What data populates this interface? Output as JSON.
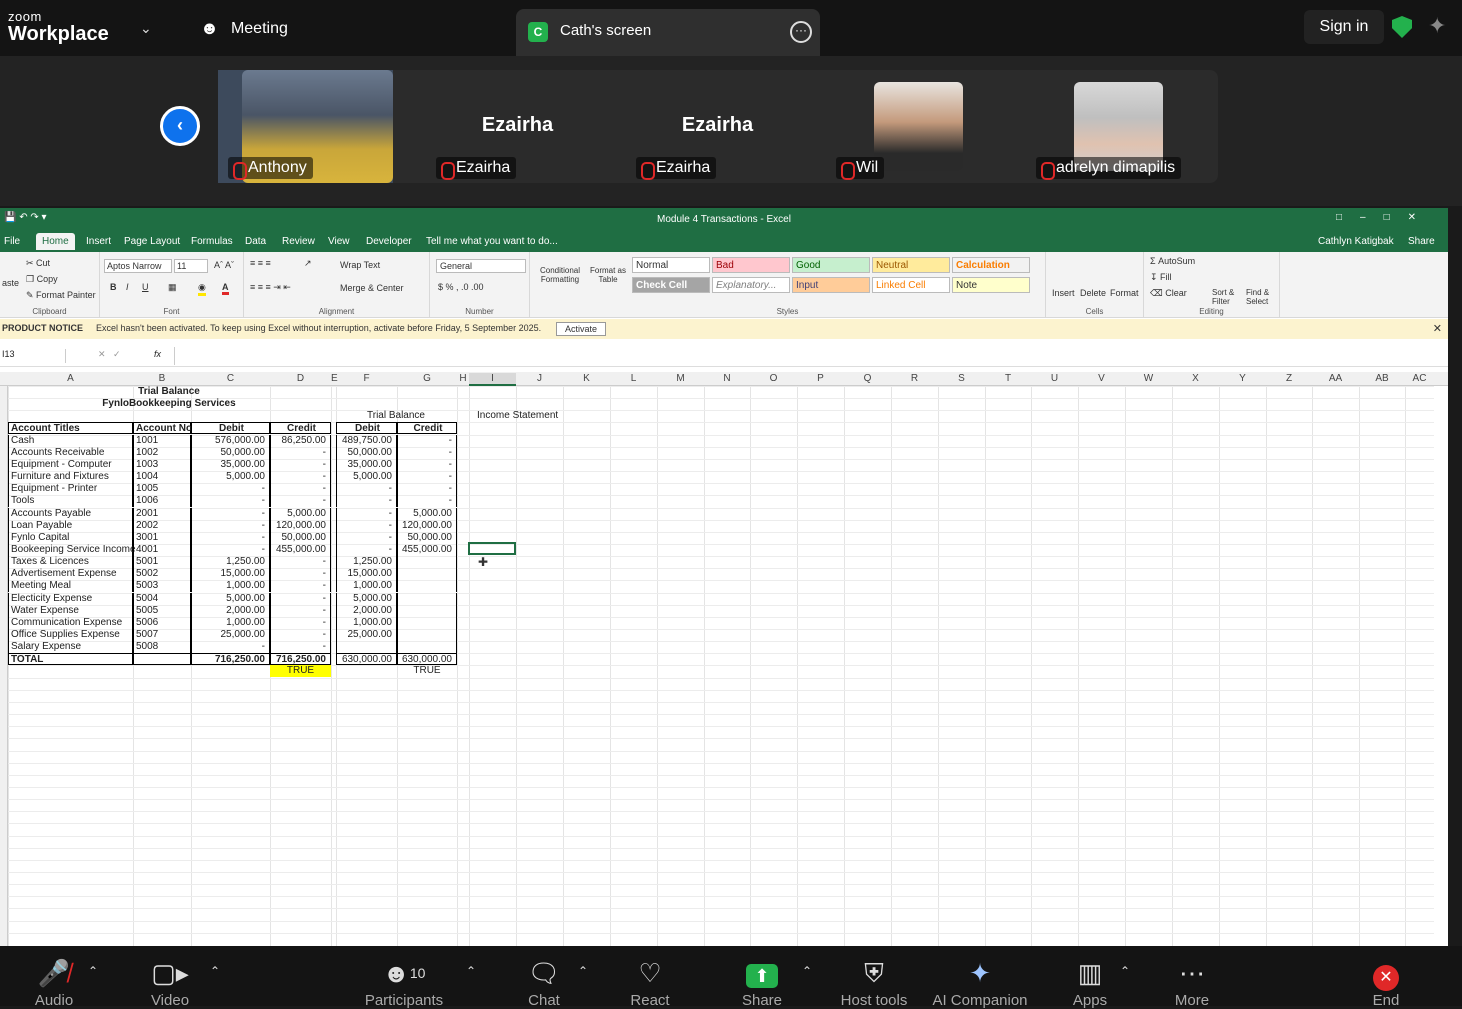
{
  "top": {
    "brand_small": "zoom",
    "brand_big": "Workplace",
    "meeting_label": "Meeting",
    "share_tab_initial": "C",
    "share_tab_title": "Cath's screen",
    "sign_in": "Sign in"
  },
  "participants": [
    {
      "name": "Anthony",
      "video": true
    },
    {
      "name": "Ezairha",
      "video": false,
      "display": "Ezairha"
    },
    {
      "name": "Ezairha",
      "video": false,
      "display": "Ezairha"
    },
    {
      "name": "Wil",
      "video": true
    },
    {
      "name": "adrelyn dimapilis",
      "video": true
    }
  ],
  "excel": {
    "title": "Module 4 Transactions - Excel",
    "menus": [
      "File",
      "Home",
      "Insert",
      "Page Layout",
      "Formulas",
      "Data",
      "Review",
      "View",
      "Developer"
    ],
    "tell_me": "Tell me what you want to do...",
    "user": "Cathlyn Katigbak",
    "share": "Share",
    "clipboard": {
      "cut": "Cut",
      "copy": "Copy",
      "painter": "Format Painter",
      "paste": "aste",
      "label": "Clipboard"
    },
    "font": {
      "name": "Aptos Narrow",
      "size": "11",
      "label": "Font"
    },
    "alignment": {
      "wrap": "Wrap Text",
      "merge": "Merge & Center",
      "label": "Alignment"
    },
    "number": {
      "format": "General",
      "label": "Number"
    },
    "cond": "Conditional Formatting",
    "fmt_table": "Format as Table",
    "styles": [
      "Normal",
      "Bad",
      "Good",
      "Neutral",
      "Calculation",
      "Check Cell",
      "Explanatory...",
      "Input",
      "Linked Cell",
      "Note"
    ],
    "styles_label": "Styles",
    "cells": [
      "Insert",
      "Delete",
      "Format"
    ],
    "cells_label": "Cells",
    "editing": {
      "autosum": "AutoSum",
      "fill": "Fill",
      "clear": "Clear",
      "sort": "Sort & Filter",
      "find": "Find & Select",
      "label": "Editing"
    },
    "notice_title": "PRODUCT NOTICE",
    "notice": "Excel hasn't been activated. To keep using Excel without interruption, activate before Friday, 5 September 2025.",
    "activate": "Activate",
    "namebox": "I13",
    "columns": [
      "A",
      "B",
      "C",
      "D",
      "E",
      "F",
      "G",
      "H",
      "I",
      "J",
      "K",
      "L",
      "M",
      "N",
      "O",
      "P",
      "Q",
      "R",
      "S",
      "T",
      "U",
      "V",
      "W",
      "X",
      "Y",
      "Z",
      "AA",
      "AB",
      "AC"
    ],
    "sheet_title": "Trial Balance",
    "company": "FynloBookkeeping Services",
    "tb2_title": "Trial Balance",
    "is_title": "Income Statement",
    "headers": [
      "Account Titles",
      "Account No",
      "Debit",
      "Credit",
      "Debit",
      "Credit"
    ],
    "rows": [
      [
        "Cash",
        "1001",
        "576,000.00",
        "86,250.00",
        "489,750.00",
        "-"
      ],
      [
        "Accounts Receivable",
        "1002",
        "50,000.00",
        "-",
        "50,000.00",
        "-"
      ],
      [
        "Equipment - Computer",
        "1003",
        "35,000.00",
        "-",
        "35,000.00",
        "-"
      ],
      [
        "Furniture and Fixtures",
        "1004",
        "5,000.00",
        "-",
        "5,000.00",
        "-"
      ],
      [
        "Equipment - Printer",
        "1005",
        "-",
        "-",
        "-",
        "-"
      ],
      [
        "Tools",
        "1006",
        "-",
        "-",
        "-",
        "-"
      ],
      [
        "Accounts Payable",
        "2001",
        "-",
        "5,000.00",
        "-",
        "5,000.00"
      ],
      [
        "Loan Payable",
        "2002",
        "-",
        "120,000.00",
        "-",
        "120,000.00"
      ],
      [
        "Fynlo Capital",
        "3001",
        "-",
        "50,000.00",
        "-",
        "50,000.00"
      ],
      [
        "Bookeeping Service Income",
        "4001",
        "-",
        "455,000.00",
        "-",
        "455,000.00"
      ],
      [
        "Taxes & Licences",
        "5001",
        "1,250.00",
        "-",
        "1,250.00",
        ""
      ],
      [
        "Advertisement Expense",
        "5002",
        "15,000.00",
        "-",
        "15,000.00",
        ""
      ],
      [
        "Meeting Meal",
        "5003",
        "1,000.00",
        "-",
        "1,000.00",
        ""
      ],
      [
        "Electicity Expense",
        "5004",
        "5,000.00",
        "-",
        "5,000.00",
        ""
      ],
      [
        "Water Expense",
        "5005",
        "2,000.00",
        "-",
        "2,000.00",
        ""
      ],
      [
        "Communication Expense",
        "5006",
        "1,000.00",
        "-",
        "1,000.00",
        ""
      ],
      [
        "Office Supplies Expense",
        "5007",
        "25,000.00",
        "-",
        "25,000.00",
        ""
      ],
      [
        "Salary Expense",
        "5008",
        "-",
        "-",
        "",
        ""
      ]
    ],
    "total": [
      "TOTAL",
      "",
      "716,250.00",
      "716,250.00",
      "630,000.00",
      "630,000.00"
    ],
    "check1": "TRUE",
    "check2": "TRUE"
  },
  "bottom": {
    "audio": "Audio",
    "video": "Video",
    "participants": "Participants",
    "participants_count": "10",
    "chat": "Chat",
    "react": "React",
    "share": "Share",
    "host_tools": "Host tools",
    "ai": "AI Companion",
    "apps": "Apps",
    "more": "More",
    "end": "End"
  },
  "colors": {
    "excel_green": "#1f6e43",
    "zoom_blue": "#0e72ed",
    "share_green": "#23b14d",
    "end_red": "#e02828"
  }
}
